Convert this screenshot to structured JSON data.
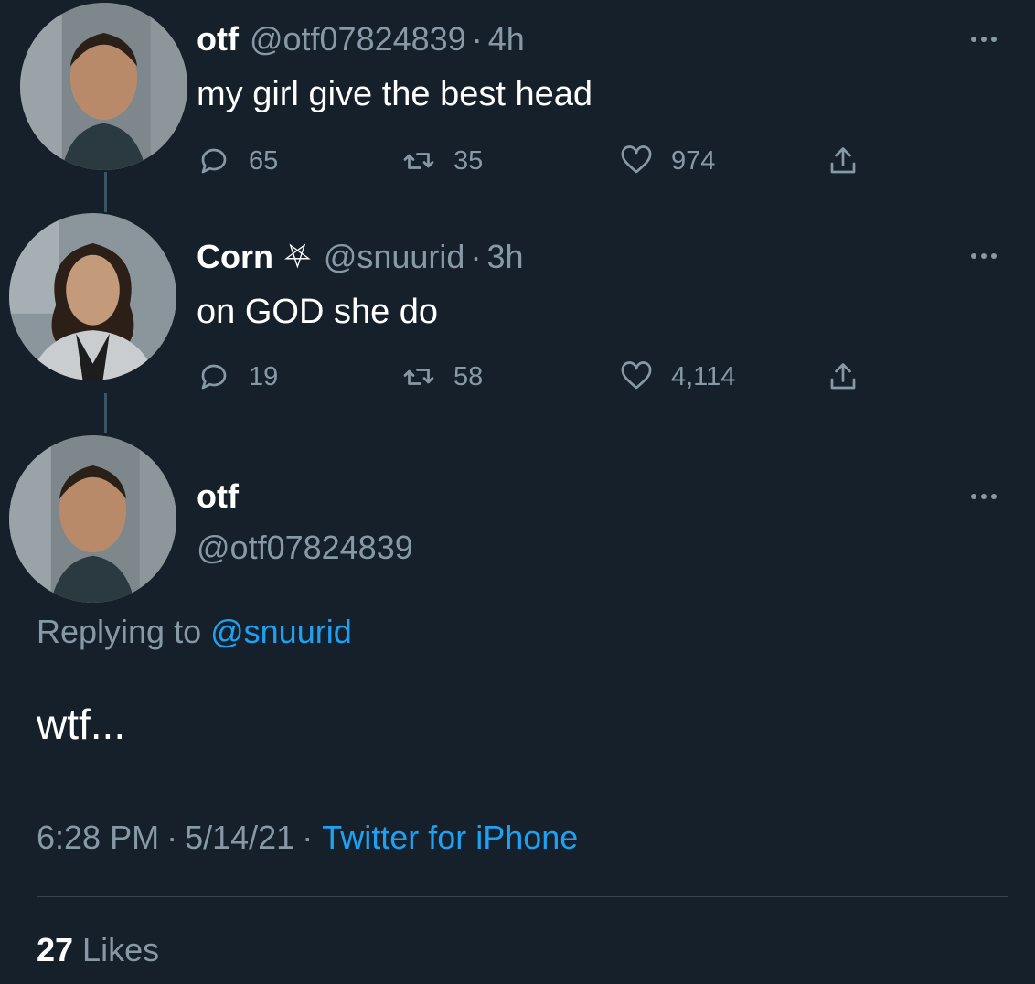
{
  "tweets": [
    {
      "name": "otf",
      "handle": "@otf07824839",
      "sep": "·",
      "time": "4h",
      "text": "my girl give the best head",
      "replies": "65",
      "retweets": "35",
      "likes": "974"
    },
    {
      "name": "Corn",
      "name_emoji": "⛧",
      "handle": "@snuurid",
      "sep": "·",
      "time": "3h",
      "text": "on GOD she do",
      "replies": "19",
      "retweets": "58",
      "likes": "4,114"
    }
  ],
  "main_tweet": {
    "name": "otf",
    "handle": "@otf07824839",
    "replying_prefix": "Replying to",
    "replying_to": "@snuurid",
    "text": "wtf...",
    "time": "6:28 PM",
    "sep1": "·",
    "date": "5/14/21",
    "sep2": "·",
    "source": "Twitter for iPhone",
    "likes_count": "27",
    "likes_label": "Likes"
  },
  "icons": {
    "reply": "reply-icon",
    "retweet": "retweet-icon",
    "like": "heart-icon",
    "share": "share-icon",
    "more": "more-icon"
  },
  "colors": {
    "background": "#15202b",
    "secondary_text": "#8899a6",
    "link": "#1da1f2"
  }
}
